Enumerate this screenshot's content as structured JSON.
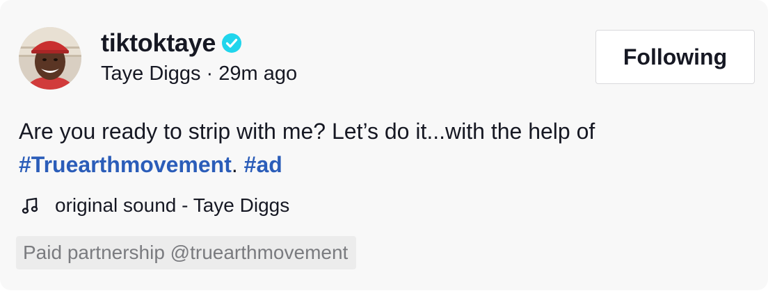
{
  "post": {
    "username": "tiktoktaye",
    "display_name": "Taye Diggs",
    "separator": "·",
    "time_ago": "29m ago",
    "follow_label": "Following",
    "caption_text": "Are you ready to strip with me? Let’s do it...with the help of ",
    "hashtag_1": "#Truearthmovement",
    "caption_mid": ". ",
    "hashtag_2": "#ad",
    "sound": "original sound - Taye Diggs",
    "paid_partnership": "Paid partnership @truearthmovement"
  },
  "icons": {
    "verified": "verified-badge-icon",
    "music": "music-note-icon"
  },
  "colors": {
    "hashtag": "#2b5db9",
    "verified": "#20d5ec",
    "card_bg": "#f8f8f8"
  }
}
